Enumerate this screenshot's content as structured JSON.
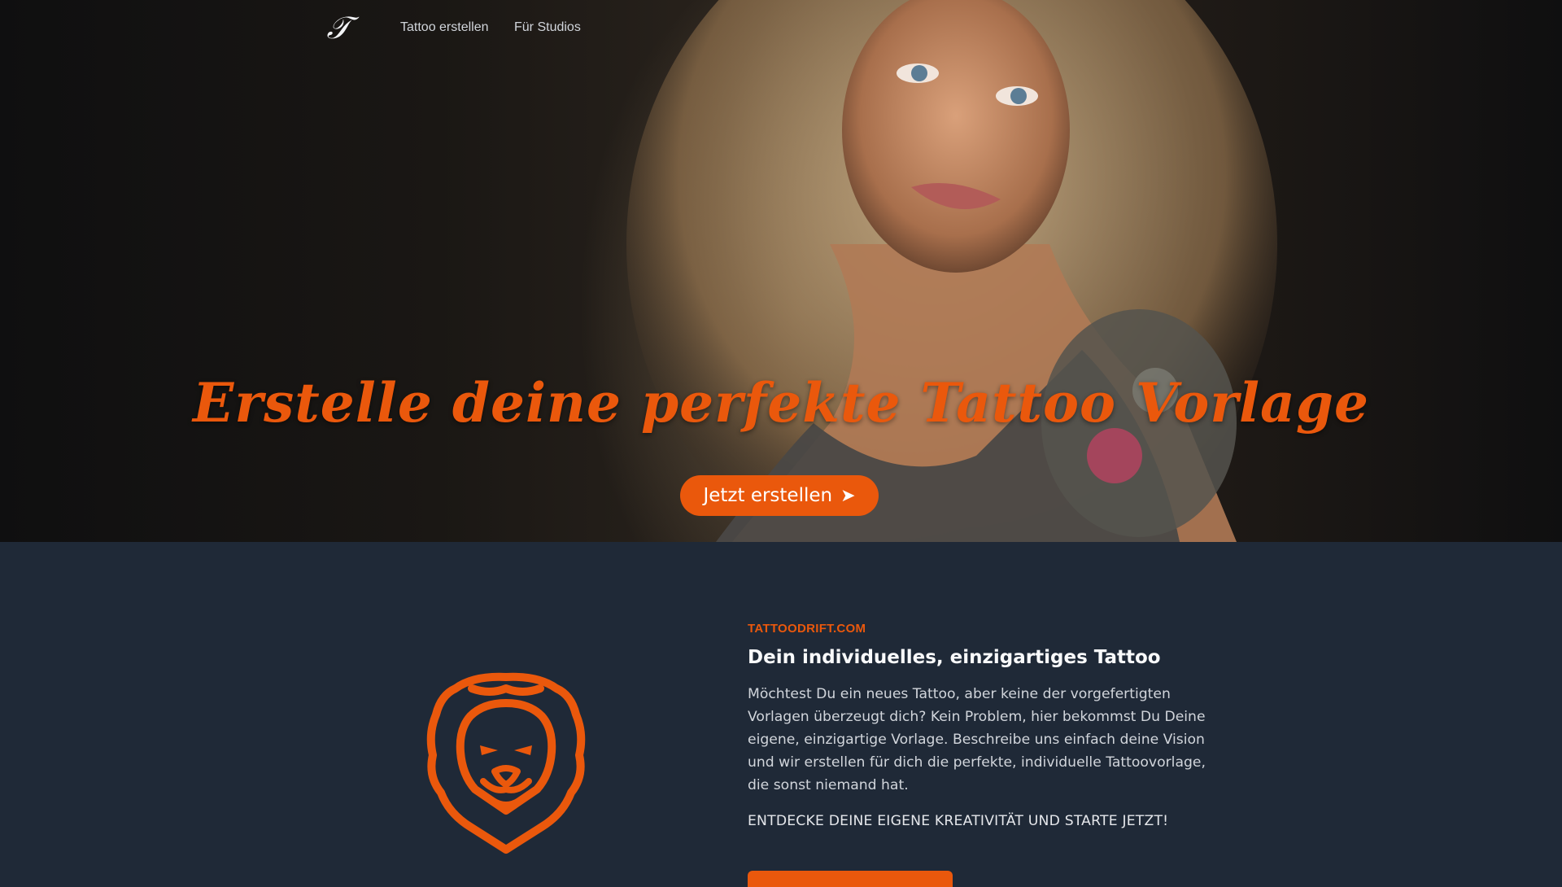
{
  "nav": {
    "logo_glyph": "𝒯",
    "links": [
      {
        "label": "Tattoo erstellen"
      },
      {
        "label": "Für Studios"
      }
    ]
  },
  "hero": {
    "headline": "Erstelle deine perfekte Tattoo Vorlage",
    "cta_label": "Jetzt erstellen",
    "cta_arrow": "➤"
  },
  "feature": {
    "eyebrow": "TATTOODRIFT.COM",
    "title": "Dein individuelles, einzigartiges Tattoo",
    "body": "Möchtest Du ein neues Tattoo, aber keine der vorgefertigten Vorlagen überzeugt dich? Kein Problem, hier bekommst Du Deine eigene, einzigartige Vorlage. Beschreibe uns einfach deine Vision und wir erstellen für dich die perfekte, individuelle Tattoovorlage, die sonst niemand hat.",
    "call_to_action": "ENTDECKE DEINE EIGENE KREATIVITÄT UND STARTE JETZT!"
  },
  "colors": {
    "accent": "#ea580c",
    "section_background": "#1f2937",
    "hero_background": "#111111"
  },
  "icons": {
    "logo": "tattoodrift-logo-icon",
    "feature_illustration": "lion-head-icon",
    "cta_arrow": "arrow-right-icon"
  }
}
